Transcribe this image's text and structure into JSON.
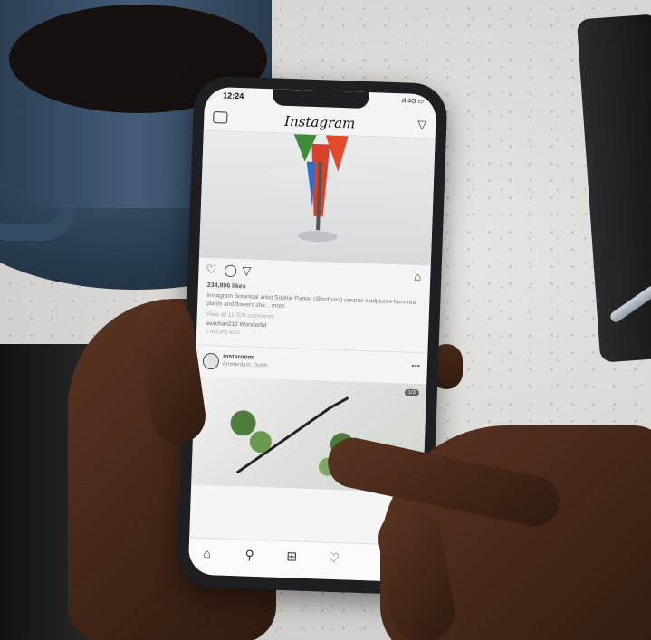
{
  "phone": {
    "status_time": "12:24",
    "battery": "ıll 4G ▭",
    "app_title": "Instagram"
  },
  "post1": {
    "likes": "234,896 likes",
    "caption": "instagram Botanical artist Sophie Parker (@sofparx) creates sculptures from real plants and flowers she... more",
    "comments_link": "View all 11,709 comments",
    "comment": "avachan212 Wonderful",
    "time_ago": "2 HOURS AGO"
  },
  "post2": {
    "username": "instaroom",
    "location": "Amsterdam, Dutch",
    "counter": "1/3"
  },
  "icons": {
    "camera": "camera-icon",
    "send": "send-icon",
    "heart": "heart-icon",
    "comment": "comment-icon",
    "share": "share-icon",
    "bookmark": "bookmark-icon",
    "home": "home-icon",
    "search": "search-icon",
    "add": "add-icon",
    "activity": "heart-icon"
  },
  "colors": {
    "cup": "#2f4560",
    "skin": "#4a2a19",
    "phone_frame": "#1e1f22"
  }
}
